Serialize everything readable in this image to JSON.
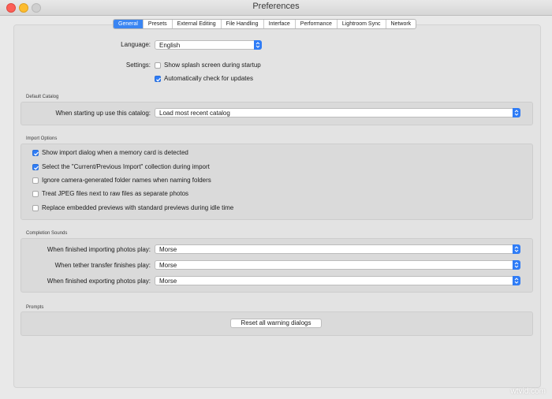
{
  "window": {
    "title": "Preferences"
  },
  "tabs": [
    "General",
    "Presets",
    "External Editing",
    "File Handling",
    "Interface",
    "Performance",
    "Lightroom Sync",
    "Network"
  ],
  "general": {
    "language_label": "Language:",
    "language_value": "English",
    "settings_label": "Settings:",
    "splash_label": "Show splash screen during startup",
    "splash_checked": false,
    "updates_label": "Automatically check for updates",
    "updates_checked": true
  },
  "default_catalog": {
    "title": "Default Catalog",
    "label": "When starting up use this catalog:",
    "value": "Load most recent catalog"
  },
  "import_options": {
    "title": "Import Options",
    "items": [
      {
        "label": "Show import dialog when a memory card is detected",
        "checked": true
      },
      {
        "label": "Select the \"Current/Previous Import\" collection during import",
        "checked": true
      },
      {
        "label": "Ignore camera-generated folder names when naming folders",
        "checked": false
      },
      {
        "label": "Treat JPEG files next to raw files as separate photos",
        "checked": false
      },
      {
        "label": "Replace embedded previews with standard previews during idle time",
        "checked": false
      }
    ]
  },
  "completion_sounds": {
    "title": "Completion Sounds",
    "rows": [
      {
        "label": "When finished importing photos play:",
        "value": "Morse"
      },
      {
        "label": "When tether transfer finishes play:",
        "value": "Morse"
      },
      {
        "label": "When finished exporting photos play:",
        "value": "Morse"
      }
    ]
  },
  "prompts": {
    "title": "Prompts",
    "reset_button": "Reset all warning dialogs"
  },
  "watermark": "wtvid.com",
  "colors": {
    "accent": "#2f7cf6",
    "background": "#e9e9e9"
  }
}
